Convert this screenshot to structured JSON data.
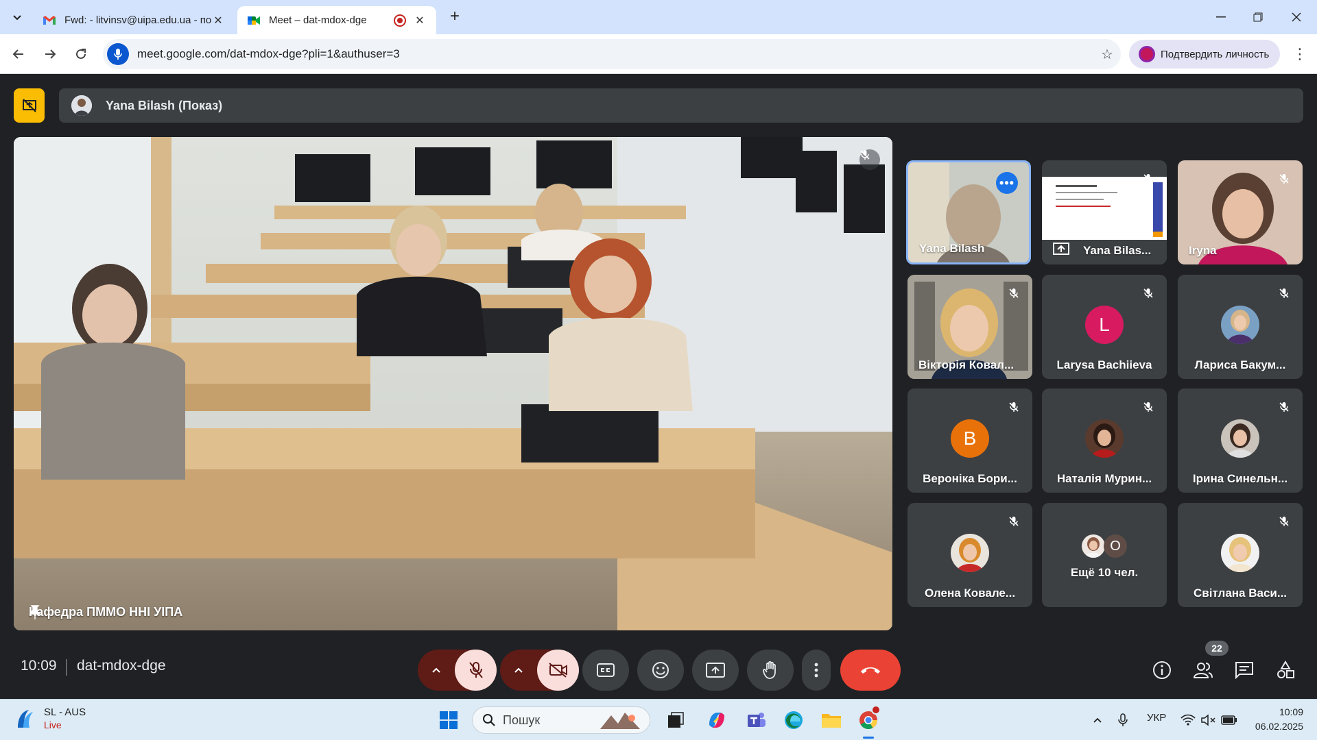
{
  "browser": {
    "tabs": [
      {
        "title": "Fwd: - litvinsv@uipa.edu.ua - по",
        "icon": "gmail-icon",
        "active": false
      },
      {
        "title": "Meet – dat-mdox-dge",
        "icon": "meet-icon",
        "active": true
      }
    ],
    "url": "meet.google.com/dat-mdox-dge?pli=1&authuser=3",
    "profile_button": "Подтвердить личность"
  },
  "meet": {
    "presentation_title": "Yana Bilash (Показ)",
    "main_label": "Кафедра ПММО ННІ УІПА",
    "participants": [
      {
        "name": "Yana Bilash",
        "type": "video"
      },
      {
        "name": "Yana Bilas...",
        "type": "screen"
      },
      {
        "name": "Iryna",
        "type": "video"
      },
      {
        "name": "Вікторія Ковал...",
        "type": "video"
      },
      {
        "name": "Larysa Bachiieva",
        "type": "letter",
        "letter": "L",
        "color": "#d81b60"
      },
      {
        "name": "Лариса Бакум...",
        "type": "photo"
      },
      {
        "name": "Вероніка Бори...",
        "type": "letter",
        "letter": "B",
        "color": "#e8710a"
      },
      {
        "name": "Наталія Мурин...",
        "type": "photo"
      },
      {
        "name": "Ірина Синельн...",
        "type": "photo"
      },
      {
        "name": "Олена Ковале...",
        "type": "photo"
      },
      {
        "name": "Ещё 10 чел.",
        "type": "more",
        "letter": "O"
      },
      {
        "name": "Світлана Васи...",
        "type": "photo"
      }
    ],
    "time": "10:09",
    "meeting_code": "dat-mdox-dge",
    "people_count": "22"
  },
  "taskbar": {
    "weather_title": "SL - AUS",
    "weather_sub": "Live",
    "search_placeholder": "Пошук",
    "language": "УКР",
    "clock_time": "10:09",
    "clock_date": "06.02.2025"
  },
  "colors": {
    "meet_bg": "#202124",
    "tile_bg": "#3c4043",
    "hangup": "#ea4335",
    "present_badge": "#fbbc04",
    "self_border": "#8ab4f8"
  }
}
